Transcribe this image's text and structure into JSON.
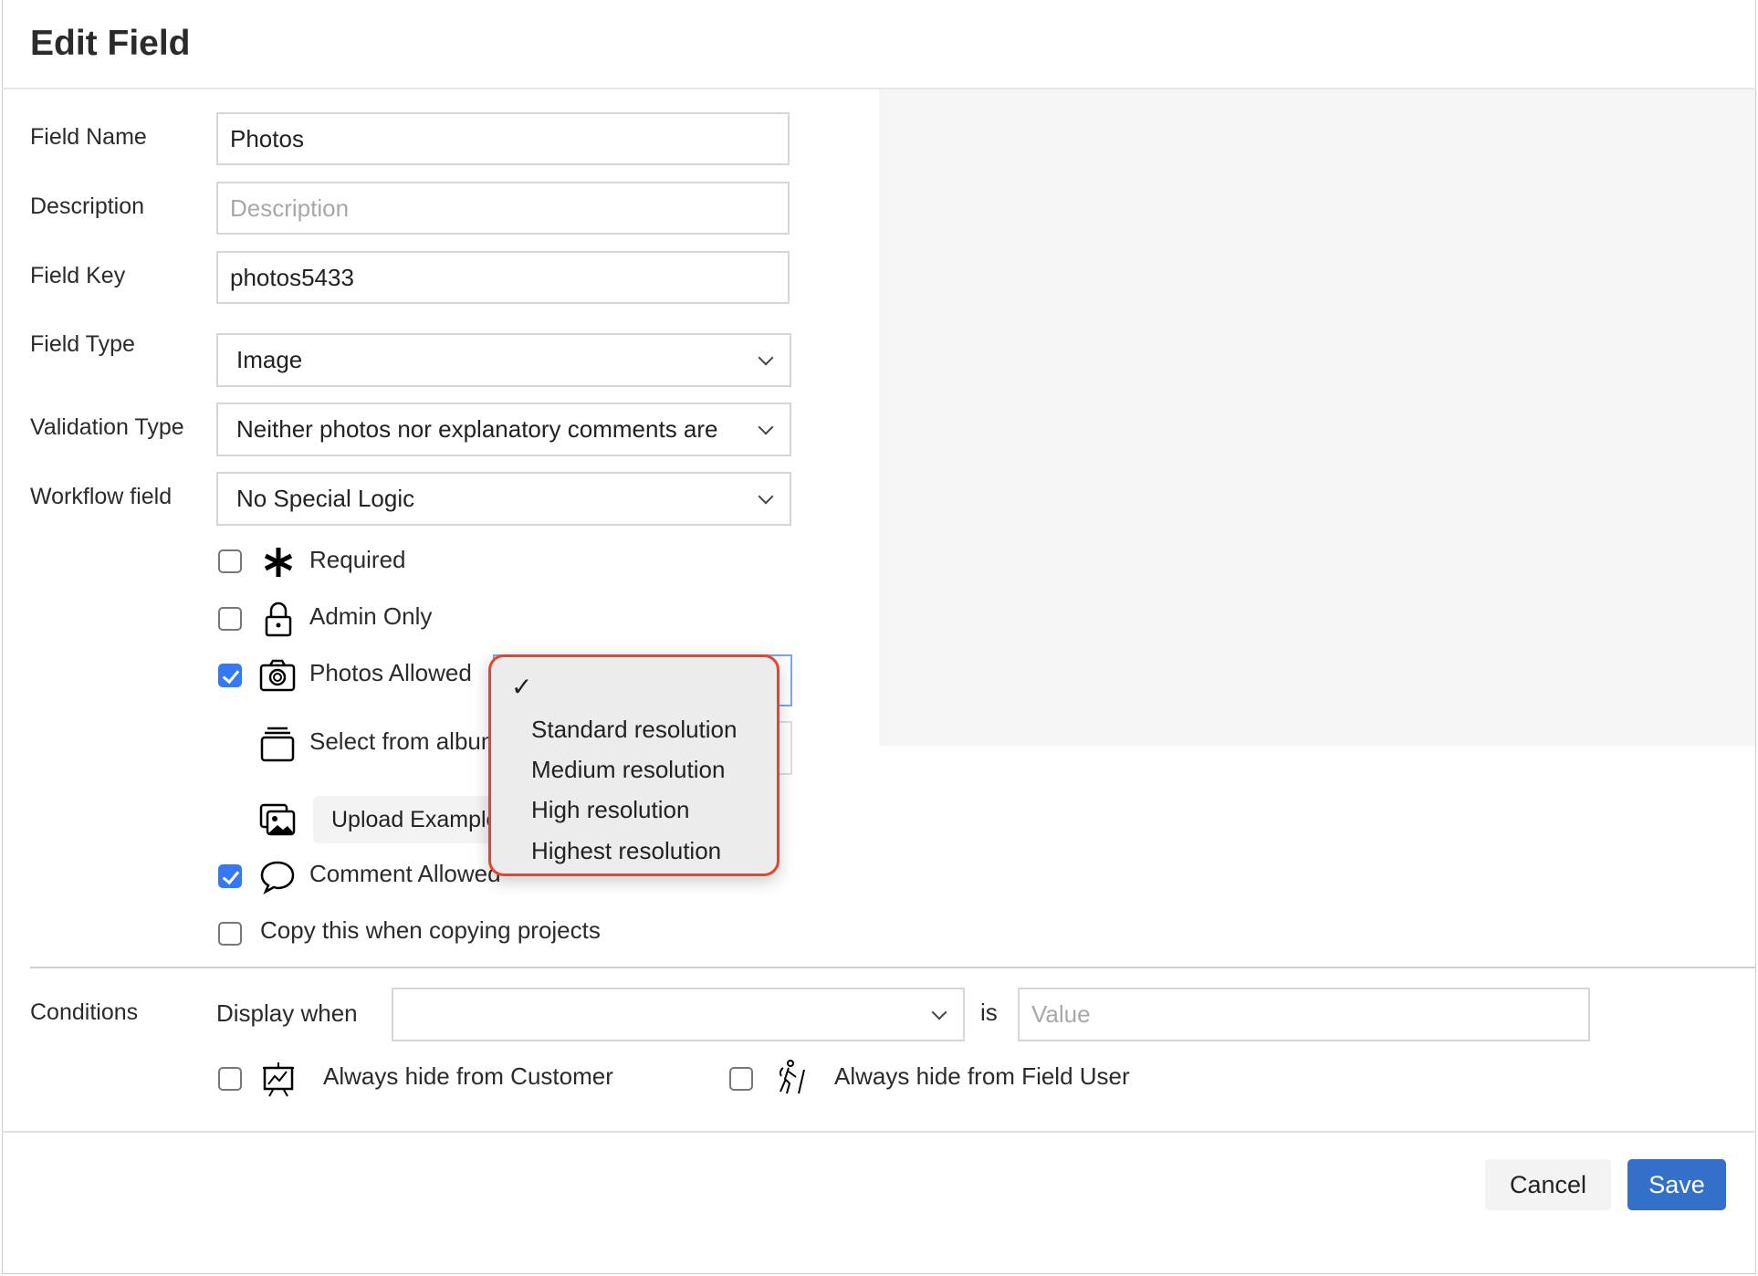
{
  "dialog": {
    "title": "Edit Field"
  },
  "form": {
    "field_name": {
      "label": "Field Name",
      "value": "Photos"
    },
    "description": {
      "label": "Description",
      "placeholder": "Description"
    },
    "field_key": {
      "label": "Field Key",
      "value": "photos5433"
    },
    "field_type": {
      "label": "Field Type",
      "value": "Image"
    },
    "validation_type": {
      "label": "Validation Type",
      "value": "Neither photos nor explanatory comments are"
    },
    "workflow_field": {
      "label": "Workflow field",
      "value": "No Special Logic"
    }
  },
  "options": {
    "required": {
      "label": "Required",
      "checked": false,
      "icon": "asterisk-icon"
    },
    "admin_only": {
      "label": "Admin Only",
      "checked": false,
      "icon": "lock-icon"
    },
    "photos_allowed": {
      "label": "Photos Allowed",
      "checked": true,
      "icon": "camera-icon"
    },
    "select_album": {
      "label": "Select from album",
      "icon": "album-icon"
    },
    "upload_example": {
      "label": "Upload Example",
      "icon": "images-icon"
    },
    "comment_allowed": {
      "label": "Comment Allowed",
      "checked": true,
      "icon": "speech-bubble-icon"
    },
    "copy_projects": {
      "label": "Copy this when copying projects",
      "checked": false
    }
  },
  "resolution_menu": {
    "selected": "",
    "items": [
      "Standard resolution",
      "Medium resolution",
      "High resolution",
      "Highest resolution"
    ]
  },
  "conditions": {
    "label": "Conditions",
    "display_when": "Display when",
    "field_value": "",
    "is": "is",
    "value_placeholder": "Value",
    "hide_customer": {
      "label": "Always hide from Customer",
      "checked": false,
      "icon": "presentation-icon"
    },
    "hide_field_user": {
      "label": "Always hide from Field User",
      "checked": false,
      "icon": "hiker-icon"
    }
  },
  "footer": {
    "cancel": "Cancel",
    "save": "Save"
  },
  "colors": {
    "primary": "#3470c9",
    "checkbox": "#3478f6",
    "menu_highlight_border": "#e8432e"
  }
}
